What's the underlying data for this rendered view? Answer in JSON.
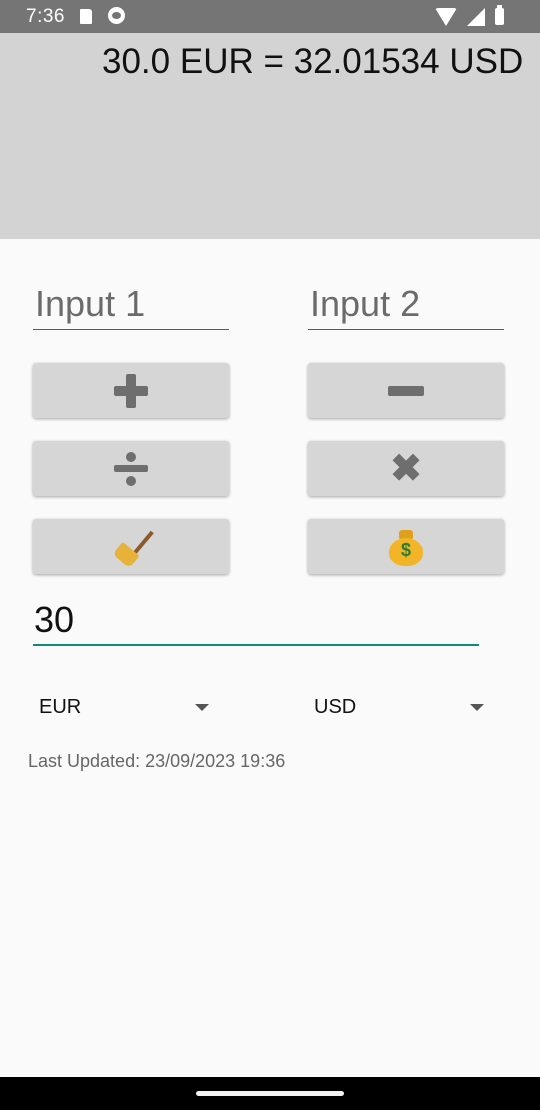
{
  "status_bar": {
    "time": "7:36",
    "icons": [
      "sd-card-icon",
      "cat-icon",
      "wifi-icon",
      "signal-icon",
      "battery-icon"
    ]
  },
  "result": {
    "text": "30.0 EUR = 32.01534 USD"
  },
  "inputs": {
    "input1_placeholder": "Input 1",
    "input2_placeholder": "Input 2"
  },
  "buttons": {
    "add_icon": "plus-icon",
    "subtract_icon": "minus-icon",
    "divide_icon": "divide-icon",
    "multiply_icon": "multiply-icon",
    "multiply_glyph": "✖",
    "clear_icon": "broom-icon",
    "convert_icon": "money-bag-icon",
    "money_sign": "$"
  },
  "amount": {
    "value": "30"
  },
  "currency": {
    "from": "EUR",
    "to": "USD"
  },
  "last_updated": "Last Updated: 23/09/2023 19:36",
  "colors": {
    "result_bg": "#d3d3d3",
    "accent": "#138a7a",
    "button_bg": "#d6d6d6"
  }
}
